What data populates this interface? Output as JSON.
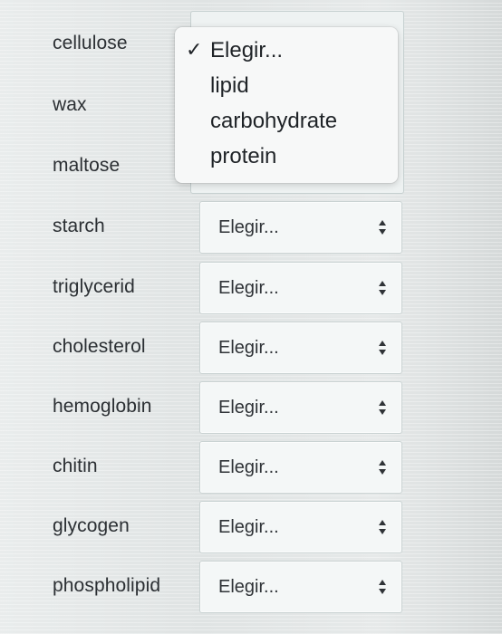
{
  "rows": [
    {
      "label": "cellulose"
    },
    {
      "label": "wax"
    },
    {
      "label": "maltose"
    },
    {
      "label": "starch",
      "value": "Elegir..."
    },
    {
      "label": "triglycerid",
      "value": "Elegir..."
    },
    {
      "label": "cholesterol",
      "value": "Elegir..."
    },
    {
      "label": "hemoglobin",
      "value": "Elegir..."
    },
    {
      "label": "chitin",
      "value": "Elegir..."
    },
    {
      "label": "glycogen",
      "value": "Elegir..."
    },
    {
      "label": "phospholipid",
      "value": "Elegir..."
    }
  ],
  "dropdown": {
    "check_mark": "✓",
    "options": [
      "Elegir...",
      "lipid",
      "carbohydrate",
      "protein"
    ],
    "selected_index": 0
  },
  "icons": {
    "select_arrows": "up-down-chevron-icon",
    "selected_check": "checkmark-icon"
  },
  "colors": {
    "text": "#2b2f33",
    "select_bg": "#f4f7f7",
    "select_border": "#c9d2d2",
    "menu_bg": "#f7f8f8"
  }
}
